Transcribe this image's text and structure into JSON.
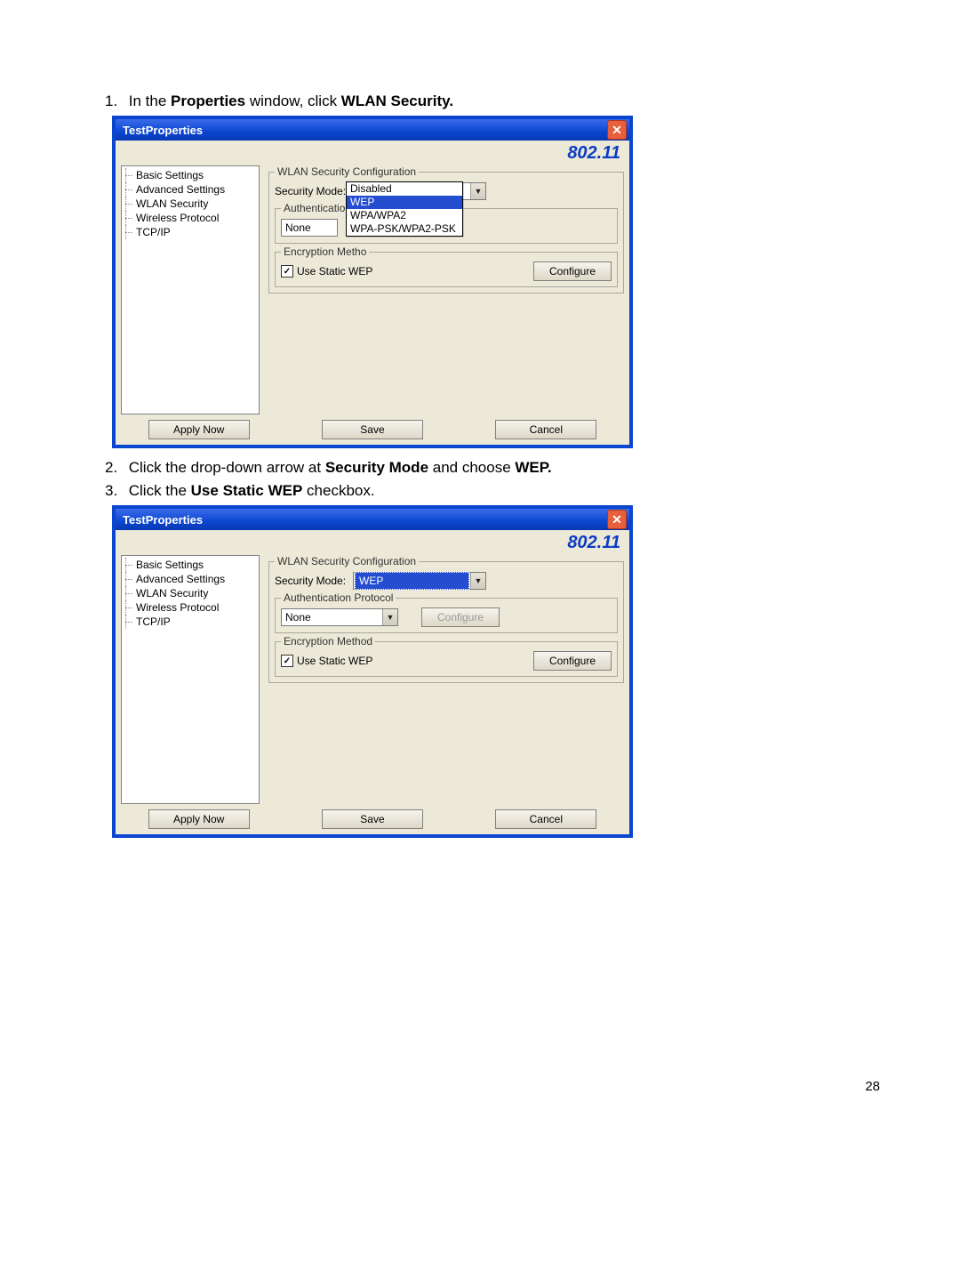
{
  "steps": {
    "s1_prefix": "1.",
    "s1_a": "In the ",
    "s1_b_bold": "Properties",
    "s1_c": " window, click ",
    "s1_d_bold": "WLAN Security.",
    "s2_prefix": "2.",
    "s2_a": "Click the drop-down arrow at ",
    "s2_b_bold": "Security Mode",
    "s2_c": " and choose ",
    "s2_d_bold": "WEP.",
    "s3_prefix": "3.",
    "s3_a": "Click the ",
    "s3_b_bold": "Use Static WEP",
    "s3_c": " checkbox."
  },
  "page_number": "28",
  "win_common": {
    "title": "TestProperties",
    "banner": "802.11",
    "close_glyph": "✕",
    "tree": [
      "Basic Settings",
      "Advanced Settings",
      "WLAN Security",
      "Wireless Protocol",
      "TCP/IP"
    ],
    "buttons": {
      "apply": "Apply Now",
      "save": "Save",
      "cancel": "Cancel"
    }
  },
  "win1": {
    "group_label": "WLAN Security Configuration",
    "sec_mode_label": "Security Mode:",
    "sec_mode_value": "WEP",
    "auth_legend_partial": "Authentication Pro",
    "auth_combo_value": "None",
    "enc_legend_partial": "Encryption Metho",
    "use_static_label": "Use Static WEP",
    "use_static_checked_glyph": "✓",
    "configure_label": "Configure",
    "dropdown_options": [
      "Disabled",
      "WEP",
      "WPA/WPA2",
      "WPA-PSK/WPA2-PSK"
    ],
    "dropdown_selected_index": 1
  },
  "win2": {
    "group_label": "WLAN Security Configuration",
    "sec_mode_label": "Security Mode:",
    "sec_mode_value": "WEP",
    "auth_legend": "Authentication Protocol",
    "auth_combo_value": "None",
    "configure1_label": "Configure",
    "enc_legend": "Encryption Method",
    "use_static_label": "Use Static WEP",
    "use_static_checked_glyph": "✓",
    "configure2_label": "Configure"
  }
}
